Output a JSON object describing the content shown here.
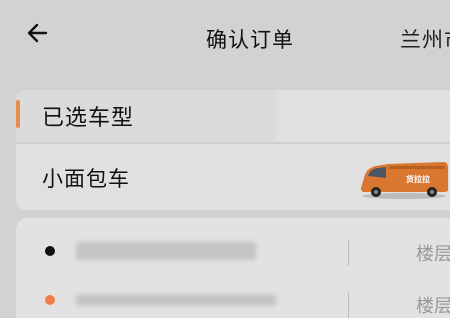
{
  "header": {
    "back_icon": "arrow-left-icon",
    "title": "确认订单",
    "city": "兰州市"
  },
  "vehicle_section": {
    "label": "已选车型",
    "vehicle_name": "小面包车",
    "vehicle_icon": "van-image"
  },
  "route": {
    "start_floor_label": "楼层",
    "end_floor_label": "楼层"
  },
  "colors": {
    "accent": "#e98a4f",
    "van": "#d9762f"
  }
}
